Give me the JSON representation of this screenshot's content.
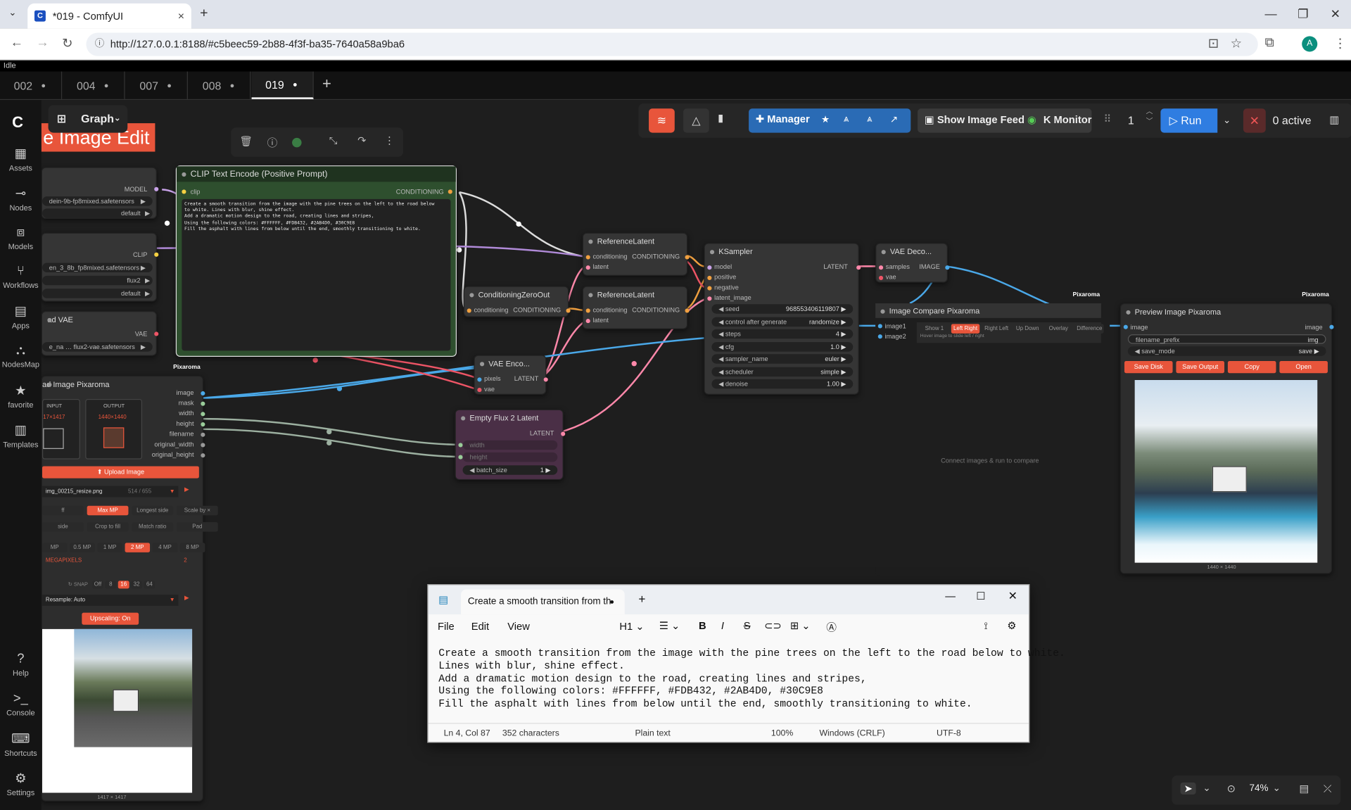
{
  "browser": {
    "tab_title": "*019 - ComfyUI",
    "url": "http://127.0.0.1:8188/#c5beec59-2b88-4f3f-ba35-7640a58a9ba6",
    "profile": "A"
  },
  "app": {
    "status": "Idle",
    "workflow_tabs": [
      "002",
      "004",
      "007",
      "008",
      "019"
    ],
    "active_tab": "019",
    "graph_label": "Graph",
    "group_title": "e Image Edit"
  },
  "sidebar": [
    {
      "icon": "assets-icon",
      "label": "Assets"
    },
    {
      "icon": "nodes-icon",
      "label": "Nodes"
    },
    {
      "icon": "models-icon",
      "label": "Models"
    },
    {
      "icon": "workflows-icon",
      "label": "Workflows"
    },
    {
      "icon": "apps-icon",
      "label": "Apps"
    },
    {
      "icon": "nodesmap-icon",
      "label": "NodesMap"
    },
    {
      "icon": "star-icon",
      "label": "favorite"
    },
    {
      "icon": "templates-icon",
      "label": "Templates"
    },
    {
      "icon": "help-icon",
      "label": "Help"
    },
    {
      "icon": "console-icon",
      "label": "Console"
    },
    {
      "icon": "keyboard-icon",
      "label": "Shortcuts"
    },
    {
      "icon": "gear-icon",
      "label": "Settings"
    }
  ],
  "toolbar": {
    "manager": "Manager",
    "show_image_feed": "Show Image Feed",
    "monitor": "Monitor",
    "batch_count": "1",
    "run": "Run",
    "active": "0 active"
  },
  "zoom": "74%",
  "nodes": {
    "clip_text": {
      "title": "CLIP Text Encode (Positive Prompt)",
      "in": "clip",
      "out": "CONDITIONING",
      "text": "Create a smooth transition from the image with the pine trees on the left to the road below\nto white. Lines with blur, shine effect.\nAdd a dramatic motion design to the road, creating lines and stripes,\nUsing the following colors: #FFFFFF, #FDB432, #2AB4D0, #30C9E8\nFill the asphalt with lines from below until the end, smoothly transitioning to white."
    },
    "loader_a": {
      "out": "MODEL",
      "w1": "dein-9b-fp8mixed.safetensors",
      "w2": "default"
    },
    "loader_b": {
      "out": "CLIP",
      "w1": "en_3_8b_fp8mixed.safetensors",
      "w2": "flux2",
      "w3": "default"
    },
    "loader_vae": {
      "title": "ad VAE",
      "out": "VAE",
      "w1": "e_na",
      "w1v": "flux2-vae.safetensors"
    },
    "ref1": {
      "title": "ReferenceLatent",
      "in1": "conditioning",
      "out": "CONDITIONING",
      "in2": "latent"
    },
    "ref2": {
      "title": "ReferenceLatent",
      "in1": "conditioning",
      "out": "CONDITIONING",
      "in2": "latent"
    },
    "czo": {
      "title": "ConditioningZeroOut",
      "in": "conditioning",
      "out": "CONDITIONING"
    },
    "ksampler": {
      "title": "KSampler",
      "inputs": [
        "model",
        "positive",
        "negative",
        "latent_image"
      ],
      "out": "LATENT",
      "widgets": [
        [
          "seed",
          "968553406119807"
        ],
        [
          "control after generate",
          "randomize"
        ],
        [
          "steps",
          "4"
        ],
        [
          "cfg",
          "1.0"
        ],
        [
          "sampler_name",
          "euler"
        ],
        [
          "scheduler",
          "simple"
        ],
        [
          "denoise",
          "1.00"
        ]
      ]
    },
    "vaedec": {
      "title": "VAE Deco...",
      "in1": "samples",
      "in2": "vae",
      "out": "IMAGE"
    },
    "vaeenc": {
      "title": "VAE Enco...",
      "in1": "pixels",
      "in2": "vae",
      "out": "LATENT"
    },
    "empty": {
      "title": "Empty Flux 2 Latent",
      "out": "LATENT",
      "w1": "width",
      "w2": "height",
      "w3": "batch_size",
      "w3v": "1"
    },
    "compare": {
      "title": "Image Compare Pixaroma",
      "brand": "Pixaroma",
      "in1": "image1",
      "in2": "image2",
      "modes": [
        "Show 1",
        "Left Right",
        "Right Left",
        "Up Down",
        "Overlay",
        "Difference"
      ],
      "hint": "Hover image to slide left / right",
      "empty": "Connect images & run to compare"
    },
    "preview": {
      "title": "Preview Image Pixaroma",
      "brand": "Pixaroma",
      "in": "image",
      "out": "image",
      "w1": "filename_prefix",
      "w1v": "img",
      "w2": "save_mode",
      "w2v": "save",
      "btns": [
        "Save Disk",
        "Save Output",
        "Copy",
        "Open"
      ],
      "dims": "1440 × 1440"
    },
    "load": {
      "title": "ad Image Pixaroma",
      "brand": "Pixaroma",
      "outs": [
        "image",
        "mask",
        "width",
        "height",
        "filename",
        "original_width",
        "original_height"
      ],
      "input_label": "INPUT",
      "input_dims": "17×1417",
      "output_label": "OUTPUT",
      "output_dims": "1440×1440",
      "upload": "Upload Image",
      "file": "img_00215_resize.png",
      "file_count": "514 / 655",
      "modes": [
        "ff",
        "Max MP",
        "Longest side",
        "Scale by ×"
      ],
      "modes2": [
        "side",
        "Crop to fill",
        "Match ratio",
        "Pad"
      ],
      "mps": [
        "MP",
        "0.5 MP",
        "1 MP",
        "2 MP",
        "4 MP",
        "8 MP"
      ],
      "mp_label": "MEGAPIXELS",
      "mp_value": "2",
      "snap": "SNAP",
      "snaps": [
        "Off",
        "8",
        "16",
        "32",
        "64"
      ],
      "resample": "Resample: Auto",
      "upscale": "Upscaling: On",
      "dims": "1417 × 1417"
    }
  },
  "notepad": {
    "tab_title": "Create a smooth transition from th",
    "menu": [
      "File",
      "Edit",
      "View"
    ],
    "heading": "H1",
    "text": "Create a smooth transition from the image with the pine trees on the left to the road below to white.\nLines with blur, shine effect.\nAdd a dramatic motion design to the road, creating lines and stripes,\nUsing the following colors: #FFFFFF, #FDB432, #2AB4D0, #30C9E8\nFill the asphalt with lines from below until the end, smoothly transitioning to white.",
    "status": {
      "pos": "Ln 4, Col 87",
      "chars": "352 characters",
      "mode": "Plain text",
      "zoom": "100%",
      "eol": "Windows (CRLF)",
      "enc": "UTF-8"
    }
  },
  "colors": {
    "accent": "#e8553b",
    "run": "#2f7de1",
    "manager": "#2a6bb5"
  }
}
